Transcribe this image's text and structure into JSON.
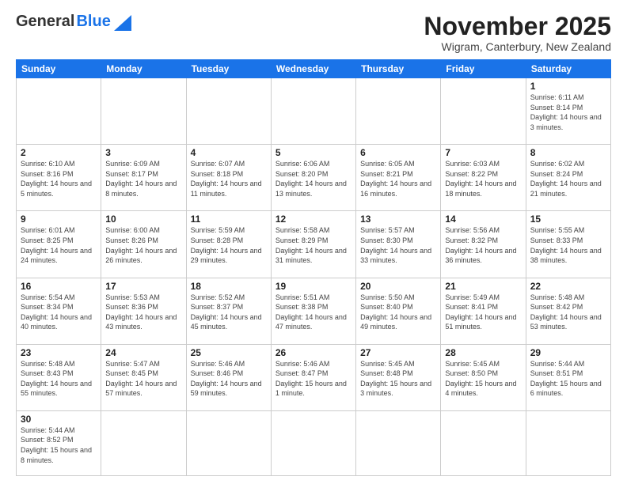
{
  "header": {
    "logo_general": "General",
    "logo_blue": "Blue",
    "month_title": "November 2025",
    "subtitle": "Wigram, Canterbury, New Zealand"
  },
  "days_of_week": [
    "Sunday",
    "Monday",
    "Tuesday",
    "Wednesday",
    "Thursday",
    "Friday",
    "Saturday"
  ],
  "weeks": [
    [
      {
        "day": "",
        "info": ""
      },
      {
        "day": "",
        "info": ""
      },
      {
        "day": "",
        "info": ""
      },
      {
        "day": "",
        "info": ""
      },
      {
        "day": "",
        "info": ""
      },
      {
        "day": "",
        "info": ""
      },
      {
        "day": "1",
        "info": "Sunrise: 6:11 AM\nSunset: 8:14 PM\nDaylight: 14 hours\nand 3 minutes."
      }
    ],
    [
      {
        "day": "2",
        "info": "Sunrise: 6:10 AM\nSunset: 8:16 PM\nDaylight: 14 hours\nand 5 minutes."
      },
      {
        "day": "3",
        "info": "Sunrise: 6:09 AM\nSunset: 8:17 PM\nDaylight: 14 hours\nand 8 minutes."
      },
      {
        "day": "4",
        "info": "Sunrise: 6:07 AM\nSunset: 8:18 PM\nDaylight: 14 hours\nand 11 minutes."
      },
      {
        "day": "5",
        "info": "Sunrise: 6:06 AM\nSunset: 8:20 PM\nDaylight: 14 hours\nand 13 minutes."
      },
      {
        "day": "6",
        "info": "Sunrise: 6:05 AM\nSunset: 8:21 PM\nDaylight: 14 hours\nand 16 minutes."
      },
      {
        "day": "7",
        "info": "Sunrise: 6:03 AM\nSunset: 8:22 PM\nDaylight: 14 hours\nand 18 minutes."
      },
      {
        "day": "8",
        "info": "Sunrise: 6:02 AM\nSunset: 8:24 PM\nDaylight: 14 hours\nand 21 minutes."
      }
    ],
    [
      {
        "day": "9",
        "info": "Sunrise: 6:01 AM\nSunset: 8:25 PM\nDaylight: 14 hours\nand 24 minutes."
      },
      {
        "day": "10",
        "info": "Sunrise: 6:00 AM\nSunset: 8:26 PM\nDaylight: 14 hours\nand 26 minutes."
      },
      {
        "day": "11",
        "info": "Sunrise: 5:59 AM\nSunset: 8:28 PM\nDaylight: 14 hours\nand 29 minutes."
      },
      {
        "day": "12",
        "info": "Sunrise: 5:58 AM\nSunset: 8:29 PM\nDaylight: 14 hours\nand 31 minutes."
      },
      {
        "day": "13",
        "info": "Sunrise: 5:57 AM\nSunset: 8:30 PM\nDaylight: 14 hours\nand 33 minutes."
      },
      {
        "day": "14",
        "info": "Sunrise: 5:56 AM\nSunset: 8:32 PM\nDaylight: 14 hours\nand 36 minutes."
      },
      {
        "day": "15",
        "info": "Sunrise: 5:55 AM\nSunset: 8:33 PM\nDaylight: 14 hours\nand 38 minutes."
      }
    ],
    [
      {
        "day": "16",
        "info": "Sunrise: 5:54 AM\nSunset: 8:34 PM\nDaylight: 14 hours\nand 40 minutes."
      },
      {
        "day": "17",
        "info": "Sunrise: 5:53 AM\nSunset: 8:36 PM\nDaylight: 14 hours\nand 43 minutes."
      },
      {
        "day": "18",
        "info": "Sunrise: 5:52 AM\nSunset: 8:37 PM\nDaylight: 14 hours\nand 45 minutes."
      },
      {
        "day": "19",
        "info": "Sunrise: 5:51 AM\nSunset: 8:38 PM\nDaylight: 14 hours\nand 47 minutes."
      },
      {
        "day": "20",
        "info": "Sunrise: 5:50 AM\nSunset: 8:40 PM\nDaylight: 14 hours\nand 49 minutes."
      },
      {
        "day": "21",
        "info": "Sunrise: 5:49 AM\nSunset: 8:41 PM\nDaylight: 14 hours\nand 51 minutes."
      },
      {
        "day": "22",
        "info": "Sunrise: 5:48 AM\nSunset: 8:42 PM\nDaylight: 14 hours\nand 53 minutes."
      }
    ],
    [
      {
        "day": "23",
        "info": "Sunrise: 5:48 AM\nSunset: 8:43 PM\nDaylight: 14 hours\nand 55 minutes."
      },
      {
        "day": "24",
        "info": "Sunrise: 5:47 AM\nSunset: 8:45 PM\nDaylight: 14 hours\nand 57 minutes."
      },
      {
        "day": "25",
        "info": "Sunrise: 5:46 AM\nSunset: 8:46 PM\nDaylight: 14 hours\nand 59 minutes."
      },
      {
        "day": "26",
        "info": "Sunrise: 5:46 AM\nSunset: 8:47 PM\nDaylight: 15 hours\nand 1 minute."
      },
      {
        "day": "27",
        "info": "Sunrise: 5:45 AM\nSunset: 8:48 PM\nDaylight: 15 hours\nand 3 minutes."
      },
      {
        "day": "28",
        "info": "Sunrise: 5:45 AM\nSunset: 8:50 PM\nDaylight: 15 hours\nand 4 minutes."
      },
      {
        "day": "29",
        "info": "Sunrise: 5:44 AM\nSunset: 8:51 PM\nDaylight: 15 hours\nand 6 minutes."
      }
    ],
    [
      {
        "day": "30",
        "info": "Sunrise: 5:44 AM\nSunset: 8:52 PM\nDaylight: 15 hours\nand 8 minutes."
      },
      {
        "day": "",
        "info": ""
      },
      {
        "day": "",
        "info": ""
      },
      {
        "day": "",
        "info": ""
      },
      {
        "day": "",
        "info": ""
      },
      {
        "day": "",
        "info": ""
      },
      {
        "day": "",
        "info": ""
      }
    ]
  ]
}
